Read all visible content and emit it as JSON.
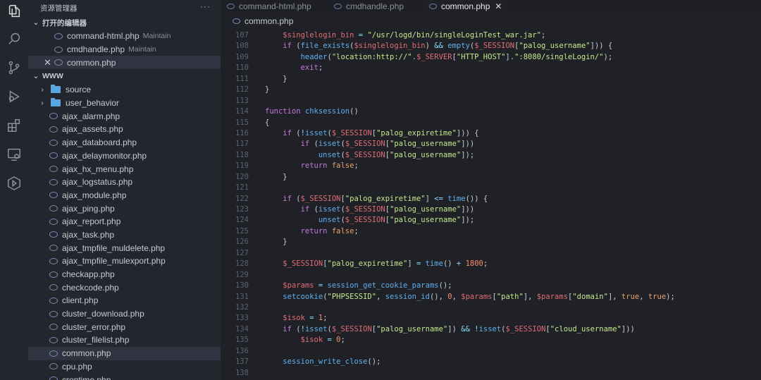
{
  "explorer": {
    "title": "资源管理器",
    "more": "···",
    "open_editors_label": "打开的编辑器",
    "open_editors": [
      {
        "name": "command-html.php",
        "desc": "Maintain"
      },
      {
        "name": "cmdhandle.php",
        "desc": "Maintain"
      },
      {
        "name": "common.php",
        "desc": ""
      }
    ],
    "workspace_label": "WWW",
    "folders": [
      "source",
      "user_behavior"
    ],
    "files": [
      "ajax_alarm.php",
      "ajax_assets.php",
      "ajax_databoard.php",
      "ajax_delaymonitor.php",
      "ajax_hx_menu.php",
      "ajax_logstatus.php",
      "ajax_module.php",
      "ajax_ping.php",
      "ajax_report.php",
      "ajax_task.php",
      "ajax_tmpfile_muldelete.php",
      "ajax_tmpfile_mulexport.php",
      "checkapp.php",
      "checkcode.php",
      "client.php",
      "cluster_download.php",
      "cluster_error.php",
      "cluster_filelist.php",
      "common.php",
      "cpu.php",
      "crontime.php"
    ],
    "selected_file": "common.php"
  },
  "tabs": [
    {
      "label": "command-html.php",
      "active": false
    },
    {
      "label": "cmdhandle.php",
      "active": false
    },
    {
      "label": "common.php",
      "active": true
    }
  ],
  "breadcrumb": "common.php",
  "editor": {
    "line_numbers": [
      "107",
      "108",
      "109",
      "110",
      "111",
      "112",
      "113",
      "114",
      "115",
      "116",
      "117",
      "118",
      "119",
      "120",
      "121",
      "122",
      "123",
      "124",
      "125",
      "126",
      "127",
      "128",
      "129",
      "130",
      "131",
      "132",
      "133",
      "134",
      "135",
      "136",
      "137",
      "138"
    ],
    "lines": [
      "    $singlelogin_bin = \"/usr/logd/bin/singleLoginTest_war.jar\";",
      "    if (file_exists($singlelogin_bin) && empty($_SESSION[\"palog_username\"])) {",
      "        header(\"location:http://\".$_SERVER[\"HTTP_HOST\"].\":8080/singleLogin/\");",
      "        exit;",
      "    }",
      "}",
      "",
      "function chksession()",
      "{",
      "    if (!isset($_SESSION[\"palog_expiretime\"])) {",
      "        if (isset($_SESSION[\"palog_username\"]))",
      "            unset($_SESSION[\"palog_username\"]);",
      "        return false;",
      "    }",
      "",
      "    if ($_SESSION[\"palog_expiretime\"] <= time()) {",
      "        if (isset($_SESSION[\"palog_username\"]))",
      "            unset($_SESSION[\"palog_username\"]);",
      "        return false;",
      "    }",
      "",
      "    $_SESSION[\"palog_expiretime\"] = time() + 1800;",
      "",
      "    $params = session_get_cookie_params();",
      "    setcookie(\"PHPSESSID\", session_id(), 0, $params[\"path\"], $params[\"domain\"], true, true);",
      "",
      "    $isok = 1;",
      "    if (!isset($_SESSION[\"palog_username\"]) && !isset($_SESSION[\"cloud_username\"]))",
      "        $isok = 0;",
      "",
      "    session_write_close();",
      ""
    ]
  },
  "colors": {
    "background": "#1f2127",
    "sidebar": "#23262d",
    "selection": "#2f3440",
    "folder": "#5aa6e0"
  },
  "icons": [
    "files-icon",
    "search-icon",
    "source-control-icon",
    "debug-icon",
    "extensions-icon",
    "remote-explorer-icon",
    "liveshare-icon"
  ]
}
